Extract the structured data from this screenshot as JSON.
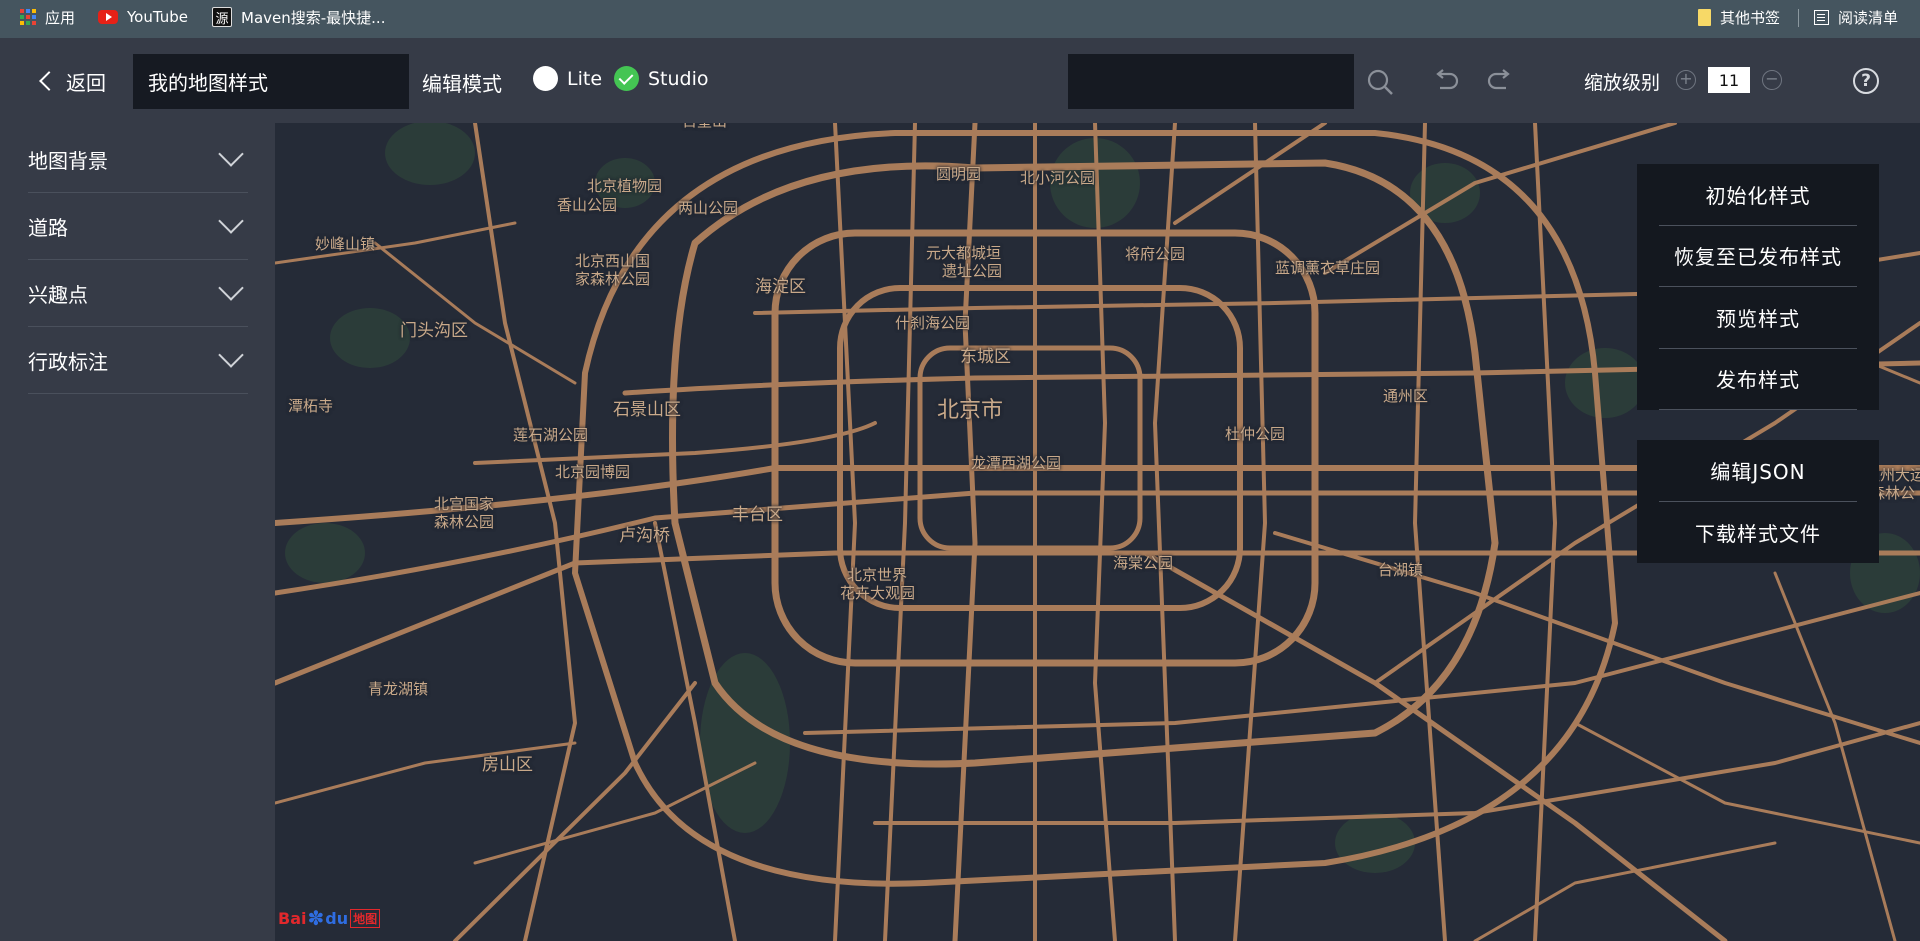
{
  "bookmarks": {
    "apps": "应用",
    "youtube": "YouTube",
    "maven": "Maven搜索-最快捷...",
    "maven_icon_char": "源",
    "other_bookmarks": "其他书签",
    "reading_list": "阅读清单"
  },
  "toolbar": {
    "back_label": "返回",
    "style_name_value": "我的地图样式",
    "edit_mode_label": "编辑模式",
    "lite_label": "Lite",
    "studio_label": "Studio",
    "selected_mode": "Studio",
    "search_value": "",
    "zoom_label": "缩放级别",
    "zoom_value": "11",
    "zoom_in_symbol": "+",
    "zoom_out_symbol": "−",
    "help_symbol": "?"
  },
  "sidebar": {
    "items": [
      {
        "label": "地图背景"
      },
      {
        "label": "道路"
      },
      {
        "label": "兴趣点"
      },
      {
        "label": "行政标注"
      }
    ]
  },
  "actions": {
    "primary": [
      {
        "label": "初始化样式"
      },
      {
        "label": "恢复至已发布样式"
      },
      {
        "label": "预览样式"
      },
      {
        "label": "发布样式"
      }
    ],
    "secondary": [
      {
        "label": "编辑JSON"
      },
      {
        "label": "下载样式文件"
      }
    ]
  },
  "map": {
    "labels": {
      "baiwangshan": "百望山",
      "yuanmingyuan": "圆明园",
      "beijing_botanical": "北京植物园",
      "xiangshan": "香山公园",
      "lianghuashan": "两山公园",
      "miaofengshan": "妙峰山镇",
      "xishan_1": "北京西山国",
      "xishan_2": "家森林公园",
      "haidian": "海淀区",
      "yuandadu_1": "元大都城垣",
      "yuandadu_2": "遗址公园",
      "beixiaohe": "北小河公园",
      "jiangfu": "将府公园",
      "lantian": "蓝调薰衣草庄园",
      "mentougou": "门头沟区",
      "shichahai": "什刹海公园",
      "dongcheng": "东城区",
      "tanzhesi": "潭柘寺",
      "shijingshan": "石景山区",
      "beijing_city": "北京市",
      "lianshihu": "莲石湖公园",
      "duzhong": "杜仲公园",
      "yuanbowan": "北京园博园",
      "longtanxihu": "龙潭西湖公园",
      "beigong_1": "北宫国家",
      "beigong_2": "森林公园",
      "lugouqiao": "卢沟桥",
      "fengtai": "丰台区",
      "haitang": "海棠公园",
      "taihu": "台湖镇",
      "shijie_1": "北京世界",
      "shijie_2": "花卉大观园",
      "qinglonghu": "青龙湖镇",
      "fangshan": "房山区",
      "tongzhou": "通州区",
      "tongzhou_park_1": "通州大运",
      "tongzhou_park_2": "森林公"
    },
    "road_color": "#a97c5a",
    "background_color": "#252b37",
    "water_color": "#1f2530",
    "green_color": "#2d4039"
  },
  "logo": {
    "bai": "Bai",
    "du": "du",
    "ditu": "地图"
  },
  "colors": {
    "accent_green": "#44c553",
    "toolbar_bg": "#363b47",
    "bookmarks_bg": "#45555f",
    "panel_bg": "#14181f"
  }
}
